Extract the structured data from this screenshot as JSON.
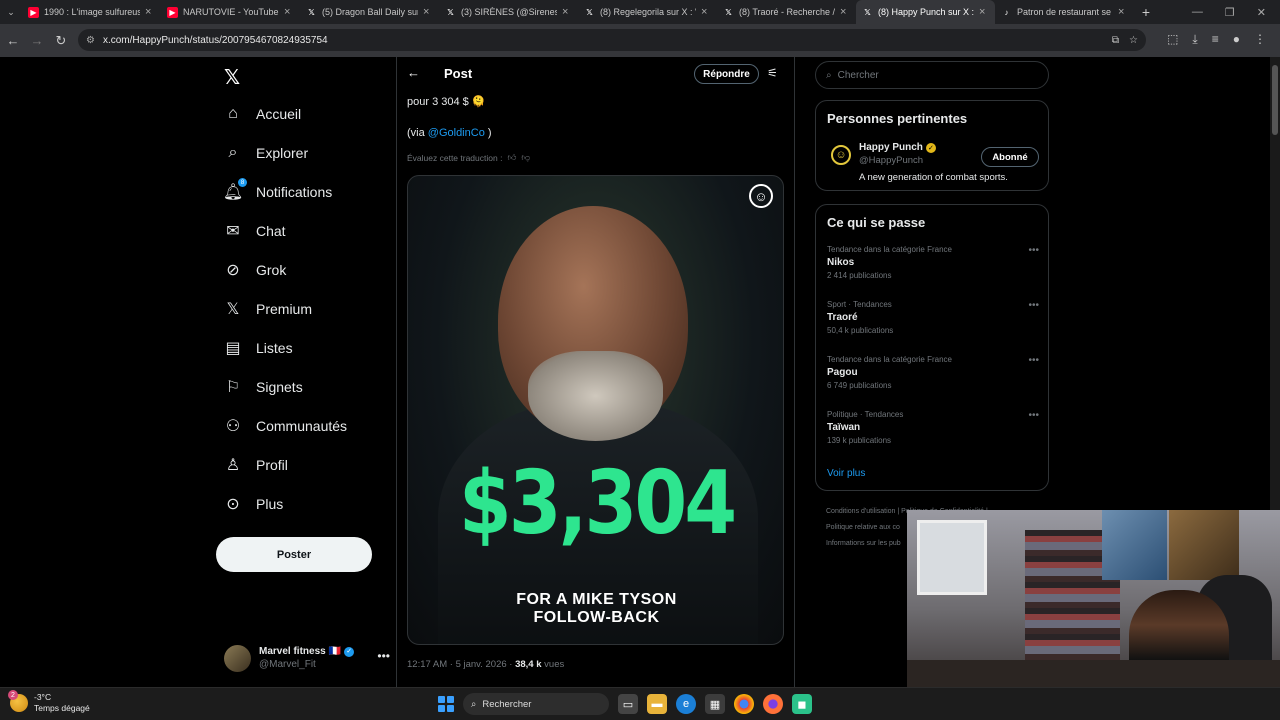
{
  "browser": {
    "tabs": [
      {
        "title": "1990 : L'image sulfureuse",
        "favicon": "youtube-icon",
        "color": "#ff0033"
      },
      {
        "title": "NARUTOVIE - YouTube",
        "favicon": "youtube-icon",
        "color": "#ff0033"
      },
      {
        "title": "(5) Dragon Ball Daily sur X",
        "favicon": "x-icon",
        "color": "#000000"
      },
      {
        "title": "(3) SIRÈNES (@SirenesFR)",
        "favicon": "x-icon",
        "color": "#000000"
      },
      {
        "title": "(8) Regelegorila sur X : \"F",
        "favicon": "x-icon",
        "color": "#000000"
      },
      {
        "title": "(8) Traoré - Recherche / X",
        "favicon": "x-icon",
        "color": "#000000"
      },
      {
        "title": "(8) Happy Punch sur X : \"",
        "favicon": "x-icon",
        "color": "#000000",
        "active": true
      },
      {
        "title": "Patron de restaurant se b",
        "favicon": "tiktok-icon",
        "color": "#111111"
      }
    ],
    "url": "x.com/HappyPunch/status/2007954670824935754"
  },
  "nav": {
    "items": [
      {
        "label": "Accueil",
        "icon": "home-icon"
      },
      {
        "label": "Explorer",
        "icon": "search-icon"
      },
      {
        "label": "Notifications",
        "icon": "bell-icon",
        "badge": "8"
      },
      {
        "label": "Chat",
        "icon": "mail-icon"
      },
      {
        "label": "Grok",
        "icon": "grok-icon"
      },
      {
        "label": "Premium",
        "icon": "x-icon"
      },
      {
        "label": "Listes",
        "icon": "list-icon"
      },
      {
        "label": "Signets",
        "icon": "bookmark-icon"
      },
      {
        "label": "Communautés",
        "icon": "people-icon"
      },
      {
        "label": "Profil",
        "icon": "person-icon"
      },
      {
        "label": "Plus",
        "icon": "more-circle-icon"
      }
    ],
    "post_label": "Poster",
    "account": {
      "name": "Marvel fitness",
      "flag": "🇫🇷",
      "handle": "@Marvel_Fit"
    }
  },
  "post": {
    "header_title": "Post",
    "reply_label": "Répondre",
    "text_line": "pour 3 304 $ 🫠",
    "via_prefix": "(via ",
    "via_mention": "@GoldinCo",
    "via_suffix": " )",
    "translate_label": "Évaluez cette traduction :",
    "media": {
      "big_text": "$3,304",
      "caption_line1": "FOR A MIKE TYSON",
      "caption_line2": "FOLLOW-BACK",
      "accent": "#2ee58f"
    },
    "time": "12:17 AM · 5 janv. 2026 · ",
    "views": "38,4 k",
    "views_label": " vues"
  },
  "sidebar": {
    "search_placeholder": "Chercher",
    "relevant_title": "Personnes pertinentes",
    "person": {
      "name": "Happy Punch",
      "handle": "@HappyPunch",
      "bio": "A new generation of combat sports.",
      "follow_label": "Abonné"
    },
    "trends_title": "Ce qui se passe",
    "trends": [
      {
        "category": "Tendance dans la catégorie France",
        "name": "Nikos",
        "count": "2 414 publications"
      },
      {
        "category": "Sport · Tendances",
        "name": "Traoré",
        "count": "50,4 k publications"
      },
      {
        "category": "Tendance dans la catégorie France",
        "name": "Pagou",
        "count": "6 749 publications"
      },
      {
        "category": "Politique · Tendances",
        "name": "Taïwan",
        "count": "139 k publications"
      }
    ],
    "see_more": "Voir plus",
    "footer": [
      "Conditions d'utilisation  |  Politique de Confidentialité  |",
      "Politique relative aux co",
      "Informations sur les pub"
    ]
  },
  "taskbar": {
    "temperature": "-3°C",
    "weather": "Temps dégagé",
    "weather_badge": "2",
    "search_label": "Rechercher"
  },
  "colors": {
    "accent": "#1d9bf0",
    "background": "#000000",
    "border": "#2f3336",
    "muted": "#71767b"
  }
}
